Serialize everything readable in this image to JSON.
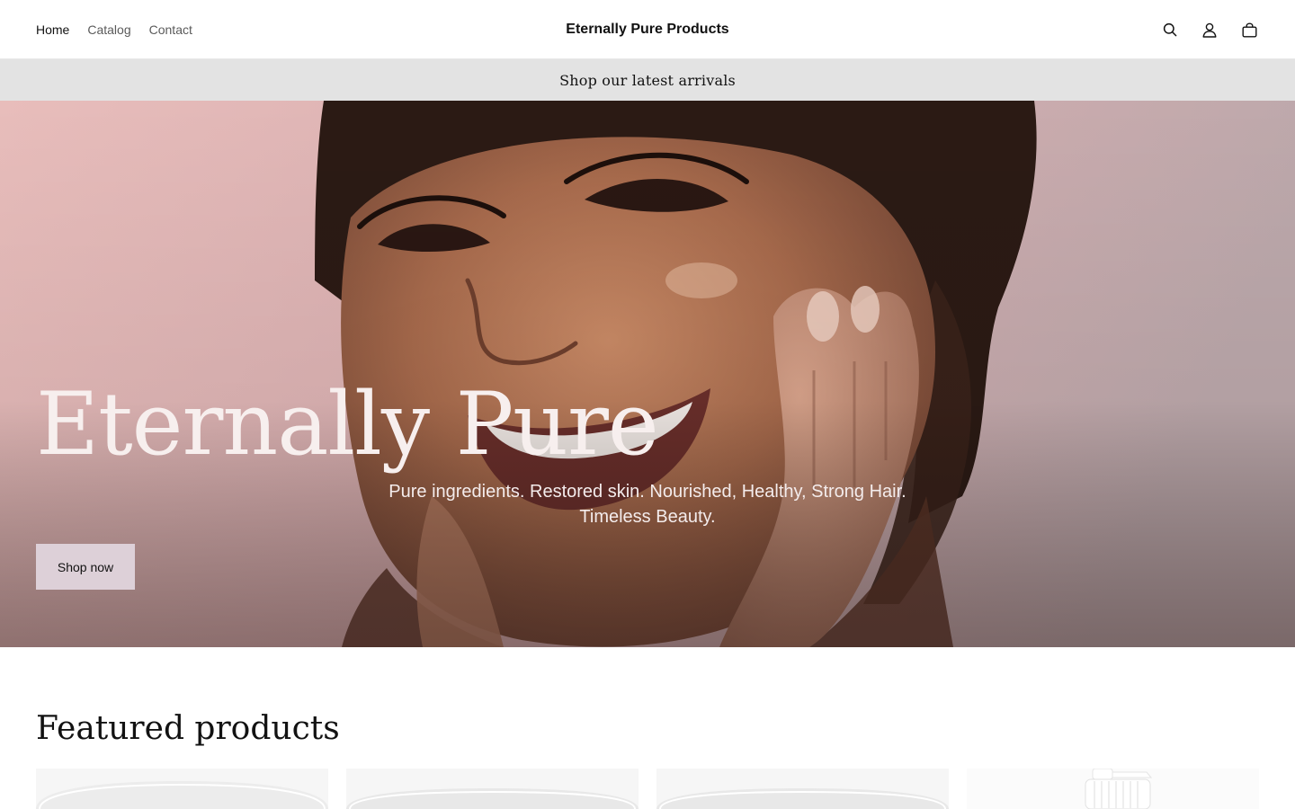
{
  "header": {
    "nav": [
      {
        "label": "Home",
        "active": true
      },
      {
        "label": "Catalog",
        "active": false
      },
      {
        "label": "Contact",
        "active": false
      }
    ],
    "brand": "Eternally Pure Products",
    "icons": [
      "search-icon",
      "account-icon",
      "cart-icon"
    ]
  },
  "announcement": {
    "text": "Shop our latest arrivals"
  },
  "hero": {
    "title": "Eternally Pure",
    "subtitle": "Pure ingredients. Restored skin. Nourished, Healthy, Strong Hair. Timeless Beauty.",
    "button_label": "Shop now",
    "image": "smiling-woman-skincare-photo"
  },
  "featured": {
    "title": "Featured products",
    "products": [
      {
        "image": "cream-jar-product-image"
      },
      {
        "image": "cream-jar-product-image"
      },
      {
        "image": "cream-jar-product-image"
      },
      {
        "image": "pump-bottle-product-image"
      }
    ]
  },
  "colors": {
    "announcement_bg": "#e3e3e3",
    "hero_button_bg": "#ddd0d8",
    "text": "#121212"
  }
}
